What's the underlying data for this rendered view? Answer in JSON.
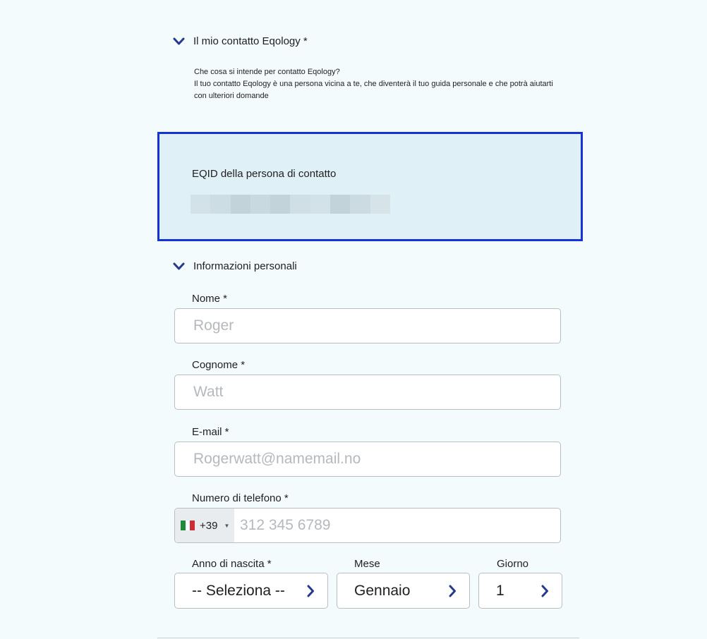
{
  "contact_section": {
    "title": "Il mio contatto Eqology *",
    "help_question": "Che cosa si intende per contatto Eqology?",
    "help_answer": "Il tuo contatto Eqology è una persona vicina a te, che diventerà il tuo guida personale e che potrà aiutarti con ulteriori domande"
  },
  "eqid": {
    "label": "EQID della persona di contatto",
    "value_blurred": true,
    "pixel_colors": [
      "#d3e2e8",
      "#cddde4",
      "#c3d3da",
      "#c9d9e0",
      "#c3d3da",
      "#d0dfe6",
      "#d3e2e8",
      "#c3d3da",
      "#ccdbe2",
      "#d6e4ea"
    ]
  },
  "personal_section": {
    "title": "Informazioni personali"
  },
  "fields": {
    "nome": {
      "label": "Nome *",
      "placeholder": "Roger"
    },
    "cognome": {
      "label": "Cognome *",
      "placeholder": "Watt"
    },
    "email": {
      "label": "E-mail *",
      "placeholder": "Rogerwatt@namemail.no"
    },
    "phone": {
      "label": "Numero di telefono *",
      "country_flag": "italy-flag",
      "dial_code": "+39",
      "placeholder": "312 345 6789"
    }
  },
  "birth": {
    "year_label": "Anno di nascita *",
    "year_value": "-- Seleziona --",
    "month_label": "Mese",
    "month_value": "Gennaio",
    "day_label": "Giorno",
    "day_value": "1"
  },
  "colors": {
    "accent": "#1533d6",
    "chevron": "#263a8c",
    "flag": [
      "#1f8a3a",
      "#ffffff",
      "#ce2b37"
    ]
  }
}
